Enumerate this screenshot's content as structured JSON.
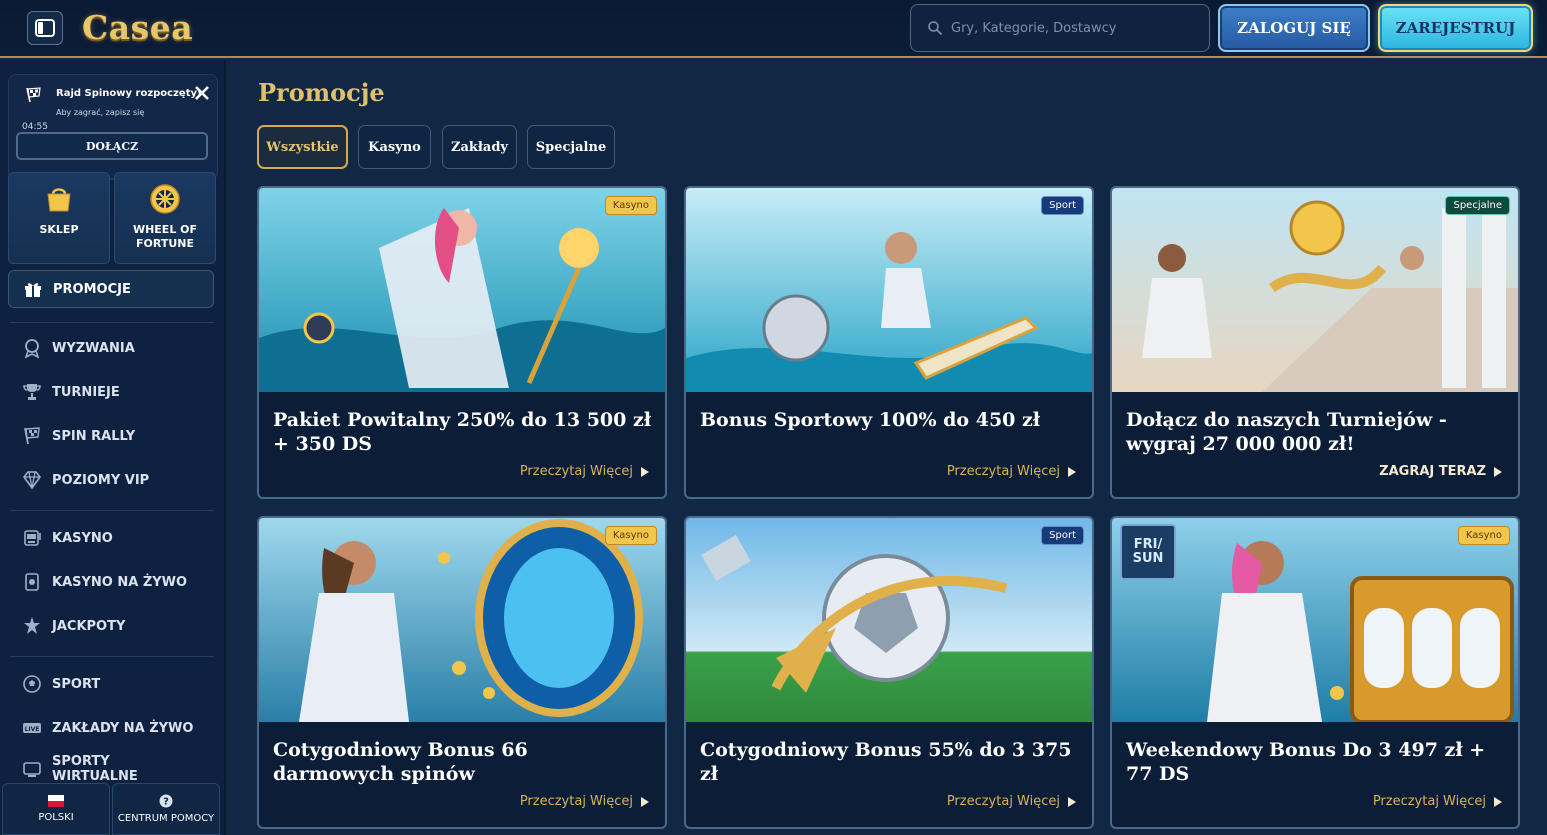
{
  "header": {
    "logo": "Casea",
    "search_placeholder": "Gry, Kategorie, Dostawcy",
    "login_label": "ZALOGUJ SIĘ",
    "register_label": "ZAREJESTRUJ"
  },
  "sidebar": {
    "rally": {
      "title": "Rajd Spinowy rozpoczęty!",
      "subtitle": "Aby zagrać, zapisz się",
      "timer": "04:55",
      "join_label": "DOŁĄCZ"
    },
    "tiles": [
      {
        "label": "SKLEP",
        "icon": "shopping-bag-icon"
      },
      {
        "label": "WHEEL OF FORTUNE",
        "icon": "fortune-wheel-icon"
      }
    ],
    "promotions_label": "PROMOCJE",
    "nav": [
      {
        "label": "WYZWANIA",
        "icon": "challenge-icon"
      },
      {
        "label": "TURNIEJE",
        "icon": "trophy-icon"
      },
      {
        "label": "SPIN RALLY",
        "icon": "spin-rally-icon"
      },
      {
        "label": "POZIOMY VIP",
        "icon": "diamond-icon"
      },
      {
        "label": "KASYNO",
        "icon": "slot-machine-icon"
      },
      {
        "label": "KASYNO NA ŻYWO",
        "icon": "live-casino-icon"
      },
      {
        "label": "JACKPOTY",
        "icon": "jackpot-icon"
      },
      {
        "label": "SPORT",
        "icon": "soccer-ball-icon"
      },
      {
        "label": "ZAKŁADY NA ŻYWO",
        "icon": "live-icon"
      },
      {
        "label": "SPORTY WIRTUALNE",
        "icon": "virtual-sports-icon"
      }
    ],
    "live_icon_text": "LIVE",
    "language_label": "POLSKI",
    "help_label": "CENTRUM POMOCY"
  },
  "main": {
    "title": "Promocje",
    "tabs": [
      "Wszystkie",
      "Kasyno",
      "Zakłady",
      "Specjalne"
    ],
    "active_tab": "Wszystkie",
    "cards": [
      {
        "badge": "Kasyno",
        "title": "Pakiet Powitalny 250% do 13 500 zł + 350 DS",
        "link": "Przeczytaj Więcej"
      },
      {
        "badge": "Sport",
        "title": "Bonus Sportowy 100% do 450 zł",
        "link": "Przeczytaj Więcej"
      },
      {
        "badge": "Specjalne",
        "title": "Dołącz do naszych Turniejów - wygraj 27 000 000 zł!",
        "link": "ZAGRAJ TERAZ"
      },
      {
        "badge": "Kasyno",
        "title": "Cotygodniowy Bonus 66 darmowych spinów",
        "link": "Przeczytaj Więcej"
      },
      {
        "badge": "Sport",
        "title": "Cotygodniowy Bonus 55% do 3 375 zł",
        "link": "Przeczytaj Więcej"
      },
      {
        "badge": "Kasyno",
        "title": "Weekendowy Bonus Do 3 497 zł + 77 DS",
        "link": "Przeczytaj Więcej",
        "day_badge": "FRI/ SUN"
      }
    ]
  },
  "colors": {
    "background": "#112844",
    "accent_gold": "#e0c06e",
    "login_blue": "#2f6ab3",
    "register_cyan": "#4ccdef",
    "badge_kasyno": "#f2c54b",
    "badge_sport": "#173a78",
    "badge_specjalne": "#0f4a3e"
  }
}
